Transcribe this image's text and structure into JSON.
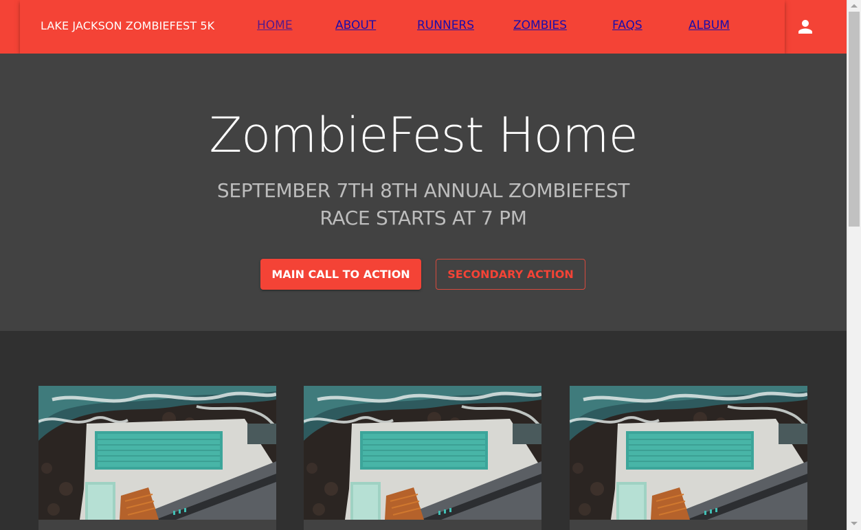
{
  "header": {
    "brand": "LAKE JACKSON ZOMBIEFEST 5K",
    "nav": [
      {
        "label": "HOME",
        "visited": true
      },
      {
        "label": "ABOUT",
        "visited": false
      },
      {
        "label": "RUNNERS",
        "visited": false
      },
      {
        "label": "ZOMBIES",
        "visited": false
      },
      {
        "label": "FAQS",
        "visited": false
      },
      {
        "label": "ALBUM",
        "visited": false
      }
    ],
    "account_icon": "person-icon"
  },
  "hero": {
    "title": "ZombieFest Home",
    "line1": "SEPTEMBER 7TH 8TH ANNUAL ZOMBIEFEST",
    "line2": "RACE STARTS AT 7 PM",
    "primary_button": "MAIN CALL TO ACTION",
    "secondary_button": "SECONDARY ACTION"
  },
  "cards": [
    {
      "image": "aerial-ocean-pool-photo"
    },
    {
      "image": "aerial-ocean-pool-photo"
    },
    {
      "image": "aerial-ocean-pool-photo"
    }
  ],
  "colors": {
    "primary": "#f44336",
    "hero_bg": "#424242",
    "page_bg": "#303030",
    "link": "#1a0dab",
    "link_visited": "#551a8b"
  }
}
